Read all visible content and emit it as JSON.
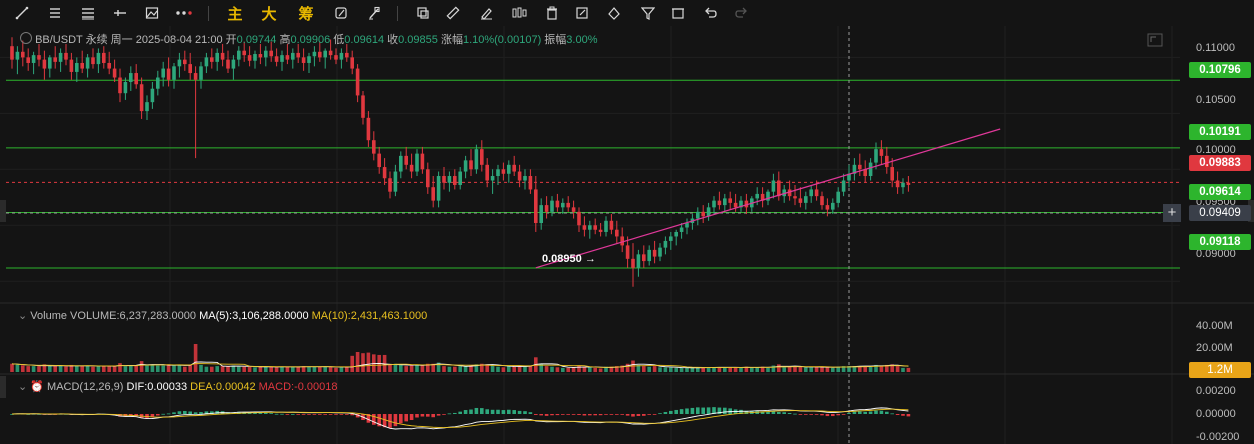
{
  "toolbar": {
    "tools": [
      "trend-line-icon",
      "horizontal-lines-icon",
      "parallel-lines-icon",
      "cross-line-icon",
      "image-icon",
      "dots-icon"
    ],
    "chinese_labels": [
      "主",
      "大",
      "筹"
    ],
    "tools2": [
      "brush-icon",
      "eraser-icon",
      "copy-icon",
      "ruler-icon",
      "pen-icon",
      "candles-icon",
      "trash-can-icon",
      "edit-icon",
      "color-icon",
      "filter-icon",
      "delete-icon",
      "undo-icon",
      "redo-icon"
    ]
  },
  "header": {
    "symbol": "BB/USDT 永续",
    "datetime": "周一 2025-08-04 21:00",
    "open_label": "开",
    "open_value": "0.09744",
    "high_label": "高",
    "high_value": "0.09906",
    "low_label": "低",
    "low_value": "0.09614",
    "close_label": "收",
    "close_value": "0.09855",
    "change_label": "涨幅",
    "change_value": "1.10%(0.00107)",
    "amp_label": "振幅",
    "amp_value": "3.00%"
  },
  "price_axis": [
    "0.11000",
    "0.10500",
    "0.10000",
    "0.09500",
    "0.09000"
  ],
  "horizontal_levels": [
    {
      "value": "0.10796",
      "color": "#2db52d"
    },
    {
      "value": "0.10191",
      "color": "#2db52d"
    },
    {
      "value": "0.09614",
      "color": "#2db52d"
    },
    {
      "value": "0.09118",
      "color": "#2db52d"
    }
  ],
  "current_price": {
    "value": "0.09883",
    "color": "#e0383f"
  },
  "cursor_price": {
    "value": "0.09409"
  },
  "low_marker": "0.08950",
  "volume": {
    "title": "Volume",
    "volume_label": "VOLUME:6,237,283.0000",
    "ma5_label": "MA(5):3,106,288.0000",
    "ma10_label": "MA(10):2,431,463.1000",
    "axis": [
      "40.00M",
      "20.00M"
    ],
    "current_tag": "1.2M"
  },
  "macd": {
    "title": "MACD(12,26,9)",
    "dif_label": "DIF:0.00033",
    "dea_label": "DEA:0.00042",
    "macd_label": "MACD:-0.00018",
    "axis": [
      "0.00200",
      "0.00000",
      "-0.00200"
    ]
  },
  "colors": {
    "up": "#2ea77c",
    "down": "#e0383f",
    "level": "#2db52d",
    "trend": "#e0389a",
    "ma5": "#ffffff",
    "ma10": "#e8c020",
    "dif": "#ffffff",
    "dea": "#e8c020"
  },
  "chart_data": {
    "type": "candlestick",
    "symbol": "BB/USDT",
    "ylim": [
      0.0885,
      0.112
    ],
    "levels": [
      0.10796,
      0.10191,
      0.09614,
      0.09118
    ],
    "current": 0.09883,
    "trendline": {
      "from": {
        "bar": 97,
        "price": 0.0912
      },
      "to": {
        "bar": 183,
        "price": 0.1036
      }
    },
    "candles": [
      [
        0.111,
        0.1118,
        0.109,
        0.1098
      ],
      [
        0.1098,
        0.111,
        0.1085,
        0.1105
      ],
      [
        0.1105,
        0.1115,
        0.1092,
        0.11
      ],
      [
        0.11,
        0.1108,
        0.1088,
        0.1095
      ],
      [
        0.1095,
        0.1105,
        0.1085,
        0.1102
      ],
      [
        0.1102,
        0.1112,
        0.1092,
        0.1098
      ],
      [
        0.1098,
        0.1106,
        0.108,
        0.109
      ],
      [
        0.109,
        0.1102,
        0.1082,
        0.11
      ],
      [
        0.11,
        0.111,
        0.109,
        0.1096
      ],
      [
        0.1096,
        0.1108,
        0.1087,
        0.1104
      ],
      [
        0.1104,
        0.1112,
        0.1093,
        0.1098
      ],
      [
        0.1098,
        0.1104,
        0.108,
        0.1087
      ],
      [
        0.1087,
        0.11,
        0.1078,
        0.1095
      ],
      [
        0.1095,
        0.1106,
        0.1086,
        0.109
      ],
      [
        0.109,
        0.1103,
        0.1082,
        0.11
      ],
      [
        0.11,
        0.1108,
        0.109,
        0.1094
      ],
      [
        0.1094,
        0.1108,
        0.1086,
        0.1104
      ],
      [
        0.1104,
        0.111,
        0.109,
        0.1095
      ],
      [
        0.1095,
        0.1105,
        0.1085,
        0.109
      ],
      [
        0.109,
        0.1098,
        0.1078,
        0.1082
      ],
      [
        0.1082,
        0.109,
        0.106,
        0.1068
      ],
      [
        0.1068,
        0.1082,
        0.1062,
        0.1078
      ],
      [
        0.1078,
        0.1092,
        0.107,
        0.1086
      ],
      [
        0.1086,
        0.1094,
        0.1072,
        0.1076
      ],
      [
        0.1076,
        0.1082,
        0.1045,
        0.1052
      ],
      [
        0.1052,
        0.1066,
        0.1044,
        0.106
      ],
      [
        0.106,
        0.1078,
        0.1054,
        0.1072
      ],
      [
        0.1072,
        0.1088,
        0.1066,
        0.1082
      ],
      [
        0.1082,
        0.1096,
        0.1074,
        0.109
      ],
      [
        0.109,
        0.11,
        0.1074,
        0.108
      ],
      [
        0.108,
        0.1095,
        0.1072,
        0.1092
      ],
      [
        0.1092,
        0.1104,
        0.1082,
        0.1098
      ],
      [
        0.1098,
        0.1106,
        0.1088,
        0.1094
      ],
      [
        0.1094,
        0.1104,
        0.108,
        0.1086
      ],
      [
        0.1086,
        0.1092,
        0.101,
        0.108
      ],
      [
        0.108,
        0.1096,
        0.1072,
        0.1092
      ],
      [
        0.1092,
        0.1104,
        0.1086,
        0.11
      ],
      [
        0.11,
        0.1108,
        0.109,
        0.1096
      ],
      [
        0.1096,
        0.1108,
        0.1088,
        0.1104
      ],
      [
        0.1104,
        0.1112,
        0.1092,
        0.1098
      ],
      [
        0.1098,
        0.1106,
        0.1086,
        0.109
      ],
      [
        0.109,
        0.1102,
        0.108,
        0.1098
      ],
      [
        0.1098,
        0.111,
        0.1092,
        0.1106
      ],
      [
        0.1106,
        0.1114,
        0.1096,
        0.1102
      ],
      [
        0.1102,
        0.111,
        0.1092,
        0.1097
      ],
      [
        0.1097,
        0.1106,
        0.109,
        0.1103
      ],
      [
        0.1103,
        0.1112,
        0.1094,
        0.11
      ],
      [
        0.11,
        0.111,
        0.1092,
        0.1106
      ],
      [
        0.1106,
        0.1114,
        0.1096,
        0.1101
      ],
      [
        0.1101,
        0.1108,
        0.1092,
        0.1096
      ],
      [
        0.1096,
        0.1106,
        0.1088,
        0.1102
      ],
      [
        0.1102,
        0.1112,
        0.1094,
        0.1098
      ],
      [
        0.1098,
        0.1108,
        0.109,
        0.1104
      ],
      [
        0.1104,
        0.1112,
        0.1095,
        0.11
      ],
      [
        0.11,
        0.1108,
        0.1088,
        0.1095
      ],
      [
        0.1095,
        0.1104,
        0.1086,
        0.1101
      ],
      [
        0.1101,
        0.111,
        0.1092,
        0.1105
      ],
      [
        0.1105,
        0.1114,
        0.1096,
        0.11
      ],
      [
        0.11,
        0.1108,
        0.109,
        0.1106
      ],
      [
        0.1106,
        0.1116,
        0.1098,
        0.1102
      ],
      [
        0.1102,
        0.1108,
        0.1094,
        0.1098
      ],
      [
        0.1098,
        0.1108,
        0.109,
        0.1104
      ],
      [
        0.1104,
        0.1112,
        0.1096,
        0.11
      ],
      [
        0.11,
        0.1106,
        0.1085,
        0.109
      ],
      [
        0.109,
        0.1094,
        0.106,
        0.1066
      ],
      [
        0.1066,
        0.107,
        0.104,
        0.1046
      ],
      [
        0.1046,
        0.1052,
        0.102,
        0.1026
      ],
      [
        0.1026,
        0.1034,
        0.1008,
        0.1014
      ],
      [
        0.1014,
        0.102,
        0.0996,
        0.1002
      ],
      [
        0.1002,
        0.101,
        0.0986,
        0.0992
      ],
      [
        0.0992,
        0.0998,
        0.0974,
        0.098
      ],
      [
        0.098,
        0.1004,
        0.0976,
        0.0998
      ],
      [
        0.0998,
        0.1016,
        0.0992,
        0.1012
      ],
      [
        0.1012,
        0.102,
        0.1,
        0.1004
      ],
      [
        0.1004,
        0.1014,
        0.0992,
        0.0998
      ],
      [
        0.0998,
        0.1018,
        0.0994,
        0.1014
      ],
      [
        0.1014,
        0.102,
        0.0996,
        0.1
      ],
      [
        0.1,
        0.1006,
        0.0978,
        0.0984
      ],
      [
        0.0984,
        0.0994,
        0.0966,
        0.0972
      ],
      [
        0.0972,
        0.0998,
        0.0966,
        0.0994
      ],
      [
        0.0994,
        0.1002,
        0.0982,
        0.0988
      ],
      [
        0.0988,
        0.0998,
        0.098,
        0.0994
      ],
      [
        0.0994,
        0.1,
        0.0982,
        0.0986
      ],
      [
        0.0986,
        0.1002,
        0.0982,
        0.0998
      ],
      [
        0.0998,
        0.1012,
        0.0992,
        0.1008
      ],
      [
        0.1008,
        0.1018,
        0.0994,
        0.1
      ],
      [
        0.1,
        0.1022,
        0.0996,
        0.1018
      ],
      [
        0.1018,
        0.1026,
        0.0998,
        0.1004
      ],
      [
        0.1004,
        0.101,
        0.0984,
        0.099
      ],
      [
        0.099,
        0.1,
        0.0978,
        0.0994
      ],
      [
        0.0994,
        0.1004,
        0.0986,
        0.1
      ],
      [
        0.1,
        0.1006,
        0.099,
        0.0996
      ],
      [
        0.0996,
        0.1008,
        0.0988,
        0.1004
      ],
      [
        0.1004,
        0.1012,
        0.0994,
        0.0998
      ],
      [
        0.0998,
        0.1004,
        0.0984,
        0.099
      ],
      [
        0.099,
        0.1,
        0.0982,
        0.0994
      ],
      [
        0.0994,
        0.1,
        0.0978,
        0.0982
      ],
      [
        0.0982,
        0.0994,
        0.0944,
        0.0952
      ],
      [
        0.0952,
        0.0974,
        0.0946,
        0.0968
      ],
      [
        0.0968,
        0.0976,
        0.0956,
        0.0962
      ],
      [
        0.0962,
        0.0976,
        0.0958,
        0.0972
      ],
      [
        0.0972,
        0.0978,
        0.0962,
        0.0966
      ],
      [
        0.0966,
        0.0974,
        0.096,
        0.097
      ],
      [
        0.097,
        0.0976,
        0.0962,
        0.0966
      ],
      [
        0.0966,
        0.0972,
        0.0956,
        0.0962
      ],
      [
        0.0962,
        0.0966,
        0.0944,
        0.095
      ],
      [
        0.095,
        0.0958,
        0.094,
        0.0946
      ],
      [
        0.0946,
        0.0954,
        0.0938,
        0.095
      ],
      [
        0.095,
        0.0956,
        0.0942,
        0.0946
      ],
      [
        0.0946,
        0.0952,
        0.094,
        0.0944
      ],
      [
        0.0944,
        0.0958,
        0.094,
        0.0954
      ],
      [
        0.0954,
        0.096,
        0.0942,
        0.0946
      ],
      [
        0.0946,
        0.0954,
        0.0934,
        0.094
      ],
      [
        0.094,
        0.0948,
        0.0926,
        0.0932
      ],
      [
        0.0932,
        0.094,
        0.0912,
        0.092
      ],
      [
        0.092,
        0.0934,
        0.0895,
        0.0912
      ],
      [
        0.0912,
        0.0928,
        0.0904,
        0.0924
      ],
      [
        0.0924,
        0.0932,
        0.0912,
        0.0918
      ],
      [
        0.0918,
        0.0932,
        0.0914,
        0.0928
      ],
      [
        0.0928,
        0.0936,
        0.0916,
        0.0922
      ],
      [
        0.0922,
        0.0934,
        0.0918,
        0.093
      ],
      [
        0.093,
        0.094,
        0.0924,
        0.0936
      ],
      [
        0.0936,
        0.0944,
        0.0928,
        0.094
      ],
      [
        0.094,
        0.0946,
        0.0932,
        0.0944
      ],
      [
        0.0944,
        0.0952,
        0.0938,
        0.0948
      ],
      [
        0.0948,
        0.0956,
        0.0942,
        0.0952
      ],
      [
        0.0952,
        0.096,
        0.0946,
        0.0956
      ],
      [
        0.0956,
        0.0966,
        0.095,
        0.0962
      ],
      [
        0.0962,
        0.0968,
        0.0952,
        0.0958
      ],
      [
        0.0958,
        0.097,
        0.0954,
        0.0966
      ],
      [
        0.0966,
        0.0976,
        0.096,
        0.0972
      ],
      [
        0.0972,
        0.098,
        0.0964,
        0.0968
      ],
      [
        0.0968,
        0.0978,
        0.0962,
        0.0974
      ],
      [
        0.0974,
        0.098,
        0.0964,
        0.097
      ],
      [
        0.097,
        0.0978,
        0.0962,
        0.0966
      ],
      [
        0.0966,
        0.0976,
        0.0962,
        0.0972
      ],
      [
        0.0972,
        0.0978,
        0.096,
        0.0966
      ],
      [
        0.0966,
        0.0976,
        0.0962,
        0.0974
      ],
      [
        0.0974,
        0.0984,
        0.0968,
        0.0978
      ],
      [
        0.0978,
        0.0984,
        0.0966,
        0.0972
      ],
      [
        0.0972,
        0.0982,
        0.0968,
        0.098
      ],
      [
        0.098,
        0.0996,
        0.0974,
        0.099
      ],
      [
        0.099,
        0.0998,
        0.0972,
        0.0976
      ],
      [
        0.0976,
        0.0986,
        0.097,
        0.0982
      ],
      [
        0.0982,
        0.099,
        0.0972,
        0.0976
      ],
      [
        0.0976,
        0.0986,
        0.0968,
        0.0974
      ],
      [
        0.0974,
        0.0984,
        0.0966,
        0.097
      ],
      [
        0.097,
        0.098,
        0.0964,
        0.0976
      ],
      [
        0.0976,
        0.0986,
        0.097,
        0.0982
      ],
      [
        0.0982,
        0.099,
        0.0972,
        0.0976
      ],
      [
        0.0976,
        0.098,
        0.0964,
        0.0968
      ],
      [
        0.0968,
        0.0974,
        0.0958,
        0.0964
      ],
      [
        0.0964,
        0.0974,
        0.096,
        0.097
      ],
      [
        0.097,
        0.0984,
        0.0966,
        0.098
      ],
      [
        0.098,
        0.0996,
        0.0976,
        0.099
      ],
      [
        0.099,
        0.1004,
        0.0984,
        0.0996
      ],
      [
        0.0996,
        0.101,
        0.099,
        0.1004
      ],
      [
        0.1004,
        0.1014,
        0.0994,
        0.1
      ],
      [
        0.1,
        0.1008,
        0.0988,
        0.0994
      ],
      [
        0.0994,
        0.101,
        0.099,
        0.1006
      ],
      [
        0.1006,
        0.1024,
        0.1,
        0.1018
      ],
      [
        0.1018,
        0.1026,
        0.1004,
        0.1012
      ],
      [
        0.1012,
        0.102,
        0.0996,
        0.1002
      ],
      [
        0.1002,
        0.101,
        0.0984,
        0.099
      ],
      [
        0.099,
        0.0998,
        0.0978,
        0.0984
      ],
      [
        0.0984,
        0.0992,
        0.0978,
        0.0988
      ],
      [
        0.0988,
        0.0994,
        0.098,
        0.0986
      ]
    ]
  }
}
